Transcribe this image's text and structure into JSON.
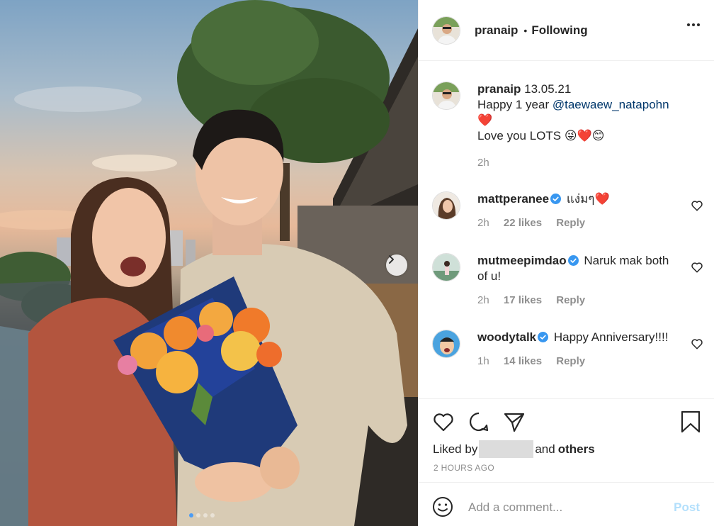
{
  "header": {
    "username": "pranaip",
    "separator": "•",
    "follow_status": "Following"
  },
  "caption": {
    "username": "pranaip",
    "date": "13.05.21",
    "line1_prefix": "Happy 1 year ",
    "mention": "@taewaew_natapohn",
    "line2_emoji": "❤️",
    "line3": "Love you LOTS 😜❤️😊",
    "time": "2h"
  },
  "comments": [
    {
      "username": "mattperanee",
      "text": "แง่มๆ❤️",
      "time": "2h",
      "likes": "22 likes",
      "reply": "Reply"
    },
    {
      "username": "mutmeepimdao",
      "text": "Naruk mak both of u!",
      "time": "2h",
      "likes": "17 likes",
      "reply": "Reply"
    },
    {
      "username": "woodytalk",
      "text": "Happy Anniversary!!!!",
      "time": "1h",
      "likes": "14 likes",
      "reply": "Reply"
    }
  ],
  "likes": {
    "prefix": "Liked by",
    "middle": "and",
    "suffix": "others"
  },
  "timestamp": "2 HOURS AGO",
  "add_comment": {
    "placeholder": "Add a comment...",
    "post_label": "Post"
  },
  "carousel": {
    "current_index": 1,
    "total": 4
  },
  "colors": {
    "verified": "#3897f0",
    "link": "#00376b",
    "heart": "#ed4956",
    "post_disabled": "#b2dffc"
  }
}
